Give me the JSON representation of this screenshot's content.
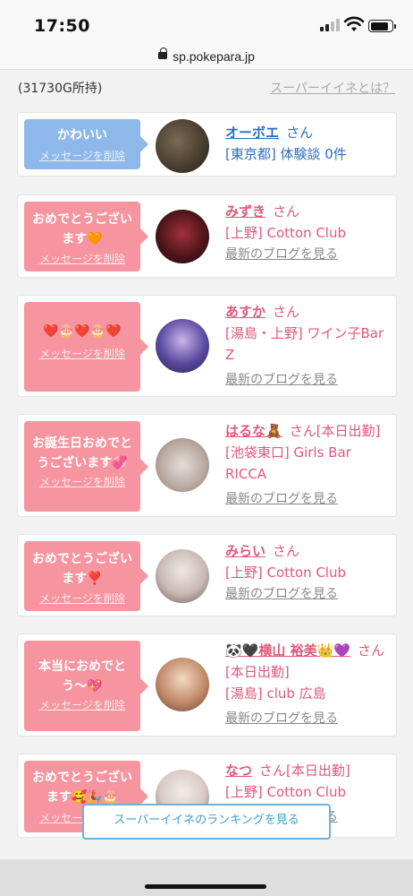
{
  "status_bar": {
    "time": "17:50",
    "signal_bars": 2,
    "battery_level": 0.85
  },
  "url_bar": {
    "url": "sp.pokepara.jp"
  },
  "header": {
    "gold": "(31730G所持)",
    "super_link": "スーパーイイネとは？"
  },
  "cards": [
    {
      "message": "かわいい",
      "delete_label": "メッセージを削除",
      "name": "オーボエ",
      "honorific": "さん",
      "line2": "[東京都] 体験談 0件",
      "line3": ""
    },
    {
      "message": "おめでとうございます🧡",
      "delete_label": "メッセージを削除",
      "name": "みずき",
      "honorific": "さん",
      "line2": "[上野] Cotton Club",
      "blog": "最新のブログを見る"
    },
    {
      "message": "❤️🎂❤️🎂❤️",
      "delete_label": "メッセージを削除",
      "name": "あすか",
      "honorific": "さん",
      "line2": "[湯島・上野] ワイン子Bar Z",
      "blog": "最新のブログを見る"
    },
    {
      "message": "お誕生日おめでとうございます💞",
      "delete_label": "メッセージを削除",
      "name": "はるな🧸",
      "honorific": "さん[本日出勤]",
      "line2": "[池袋東口] Girls Bar RICCA",
      "blog": "最新のブログを見る"
    },
    {
      "message": "おめでとうございます❣️",
      "delete_label": "メッセージを削除",
      "name": "みらい",
      "honorific": "さん",
      "line2": "[上野] Cotton Club",
      "blog": "最新のブログを見る"
    },
    {
      "message": "本当におめでとう〜💖",
      "delete_label": "メッセージを削除",
      "name": "🐼🖤横山 裕美👑💜",
      "honorific": "さん[本日出勤]",
      "line2": "[湯島] club 広島",
      "blog": "最新のブログを見る"
    },
    {
      "message": "おめでとうございます🥰🎉🎂",
      "delete_label": "メッセージを削除",
      "name": "なつ",
      "honorific": "さん[本日出勤]",
      "line2": "[上野] Cotton Club",
      "blog": "最新のブログを見る"
    }
  ],
  "footer": {
    "ranking_button": "スーパーイイネのランキングを見る"
  },
  "colors": {
    "pink_bubble": "#f6949f",
    "blue_bubble": "#8fb8ea",
    "pink_text": "#e2587a",
    "blue_text": "#2b6fbf"
  }
}
